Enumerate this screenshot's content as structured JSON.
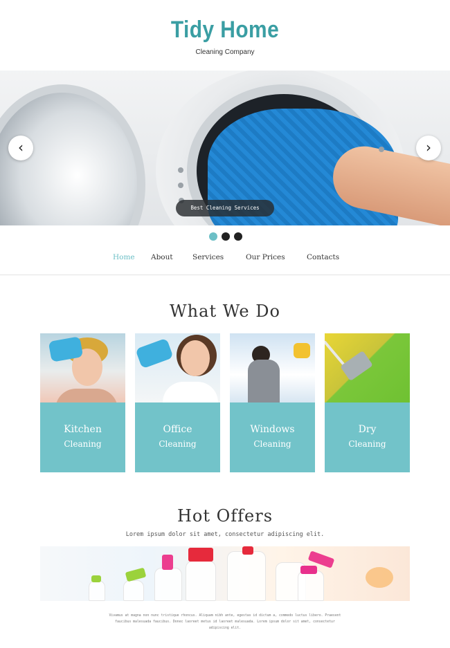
{
  "header": {
    "logo": "Tidy Home",
    "tagline": "Cleaning Company"
  },
  "slider": {
    "caption": "Best Cleaning Services",
    "prev_icon": "chevron-left-icon",
    "next_icon": "chevron-right-icon",
    "prev_glyph": "‹",
    "next_glyph": "›",
    "slides_count": 3,
    "active_slide": 1
  },
  "nav": {
    "items": [
      {
        "label": "Home"
      },
      {
        "label": "About"
      },
      {
        "label": "Services"
      },
      {
        "label": "Our Prices"
      },
      {
        "label": "Contacts"
      }
    ]
  },
  "services": {
    "title": "What We Do",
    "cards": [
      {
        "title": "Kitchen",
        "sub": "Cleaning"
      },
      {
        "title": "Office",
        "sub": "Cleaning"
      },
      {
        "title": "Windows",
        "sub": "Cleaning"
      },
      {
        "title": "Dry",
        "sub": "Cleaning"
      }
    ]
  },
  "offers": {
    "title": "Hot Offers",
    "subtitle": "Lorem ipsum dolor sit amet, consectetur adipiscing elit.",
    "body": "Vivamus at magna non nunc tristique rhoncus. Aliquam nibh ante, egestas id dictum a, commodo luctus libero. Praesent faucibus malesuada faucibus. Donec laoreet metus id laoreet malesuada. Lorem ipsum dolor sit amet, consectetur adipiscing elit."
  },
  "colors": {
    "accent": "#6cbfc6",
    "logo": "#3a9ea3",
    "card": "#72c3c9"
  }
}
